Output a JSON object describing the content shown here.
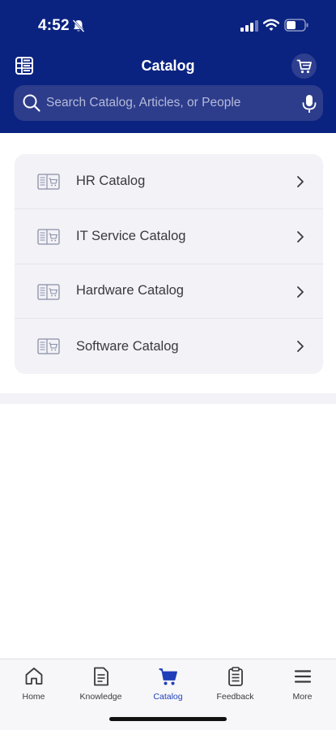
{
  "status_bar": {
    "time": "4:52",
    "icons": [
      "bell-slash-icon",
      "signal-icon",
      "wifi-icon",
      "battery-icon"
    ]
  },
  "header": {
    "title": "Catalog",
    "left_icon": "menu-grid-icon",
    "right_icon": "cart-icon"
  },
  "search": {
    "placeholder": "Search Catalog, Articles, or People",
    "value": "",
    "icon": "search-icon",
    "voice_icon": "mic-icon"
  },
  "catalogs": [
    {
      "label": "HR Catalog",
      "icon": "catalog-icon"
    },
    {
      "label": "IT Service Catalog",
      "icon": "catalog-icon"
    },
    {
      "label": "Hardware Catalog",
      "icon": "catalog-icon"
    },
    {
      "label": "Software Catalog",
      "icon": "catalog-icon"
    }
  ],
  "tabs": [
    {
      "label": "Home",
      "icon": "home-icon",
      "active": false
    },
    {
      "label": "Knowledge",
      "icon": "document-icon",
      "active": false
    },
    {
      "label": "Catalog",
      "icon": "cart-icon",
      "active": true
    },
    {
      "label": "Feedback",
      "icon": "clipboard-icon",
      "active": false
    },
    {
      "label": "More",
      "icon": "hamburger-icon",
      "active": false
    }
  ],
  "colors": {
    "header_bg": "#0b2380",
    "search_bg": "#2d3c8b",
    "card_bg": "#f2f2f7",
    "active_tab": "#1f3fb8",
    "inactive_tab": "#3a3a3c"
  }
}
